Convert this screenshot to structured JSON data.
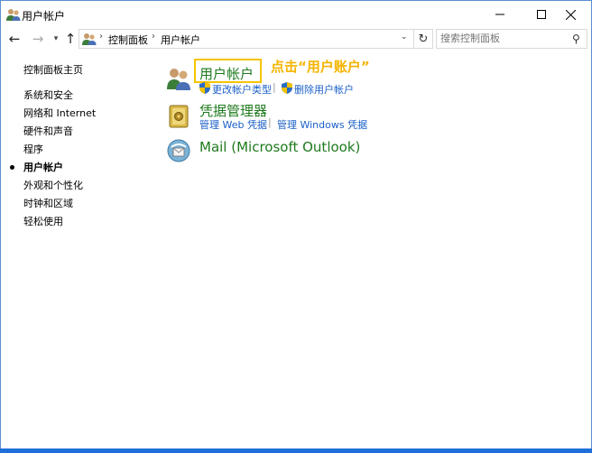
{
  "window": {
    "title": "用户帐户"
  },
  "address": {
    "crumbs": [
      "控制面板",
      "用户帐户"
    ],
    "separator": "›"
  },
  "search": {
    "placeholder": "搜索控制面板"
  },
  "sidebar": {
    "home": "控制面板主页",
    "items": [
      {
        "label": "系统和安全",
        "active": false
      },
      {
        "label": "网络和 Internet",
        "active": false
      },
      {
        "label": "硬件和声音",
        "active": false
      },
      {
        "label": "程序",
        "active": false
      },
      {
        "label": "用户帐户",
        "active": true
      },
      {
        "label": "外观和个性化",
        "active": false
      },
      {
        "label": "时钟和区域",
        "active": false
      },
      {
        "label": "轻松使用",
        "active": false
      }
    ]
  },
  "main": {
    "categories": [
      {
        "title": "用户帐户",
        "icon": "users-icon",
        "links": [
          "更改帐户类型",
          "删除用户帐户"
        ]
      },
      {
        "title": "凭据管理器",
        "icon": "vault-icon",
        "links": [
          "管理 Web 凭据",
          "管理 Windows 凭据"
        ]
      },
      {
        "title": "Mail (Microsoft Outlook)",
        "icon": "mail-icon",
        "links": []
      }
    ]
  },
  "annotation": {
    "text": "点击“用户账户”",
    "color": "#f5b400"
  },
  "colors": {
    "category_title": "#1e7a1e",
    "link": "#1a5fc8",
    "highlight": "#f5c400",
    "taskbar": "#1e6fd9"
  }
}
